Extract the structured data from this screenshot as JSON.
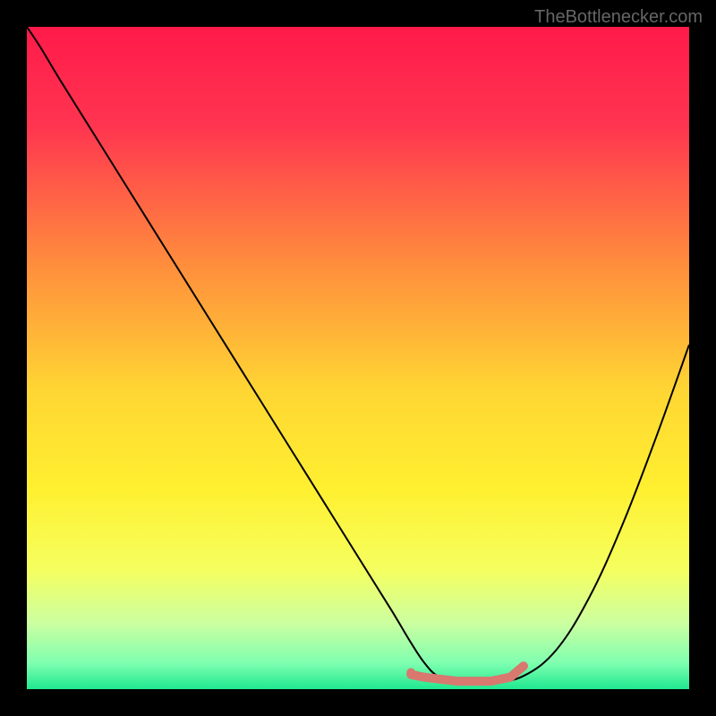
{
  "watermark": "TheBottlenecker.com",
  "chart_data": {
    "type": "line",
    "title": "",
    "xlabel": "",
    "ylabel": "",
    "xlim": [
      0,
      100
    ],
    "ylim": [
      0,
      100
    ],
    "background_gradient": {
      "stops": [
        {
          "offset": 0,
          "color": "#ff1a4a"
        },
        {
          "offset": 15,
          "color": "#ff3550"
        },
        {
          "offset": 35,
          "color": "#ff8a3d"
        },
        {
          "offset": 55,
          "color": "#ffd633"
        },
        {
          "offset": 70,
          "color": "#fff030"
        },
        {
          "offset": 82,
          "color": "#f5ff60"
        },
        {
          "offset": 90,
          "color": "#ccffa0"
        },
        {
          "offset": 96,
          "color": "#80ffb0"
        },
        {
          "offset": 100,
          "color": "#20e890"
        }
      ]
    },
    "series": [
      {
        "name": "curve",
        "color": "#000000",
        "stroke_width": 2,
        "x": [
          0,
          2,
          5,
          10,
          15,
          20,
          25,
          30,
          35,
          40,
          45,
          50,
          55,
          58,
          60,
          62,
          65,
          70,
          75,
          80,
          85,
          90,
          95,
          100
        ],
        "y": [
          100,
          97,
          92,
          84,
          76,
          68,
          60,
          52,
          44,
          36,
          28,
          20,
          12,
          7,
          4,
          2,
          1,
          1,
          2,
          6,
          14,
          25,
          38,
          52
        ]
      },
      {
        "name": "highlight",
        "color": "#d8786f",
        "stroke_width": 10,
        "type": "segment",
        "x": [
          58,
          60,
          65,
          70,
          73,
          75
        ],
        "y": [
          2.2,
          1.8,
          1.2,
          1.2,
          1.8,
          3.5
        ]
      }
    ],
    "markers": [
      {
        "name": "dot",
        "x": 58,
        "y": 2.5,
        "r": 5,
        "color": "#d8786f"
      }
    ]
  }
}
